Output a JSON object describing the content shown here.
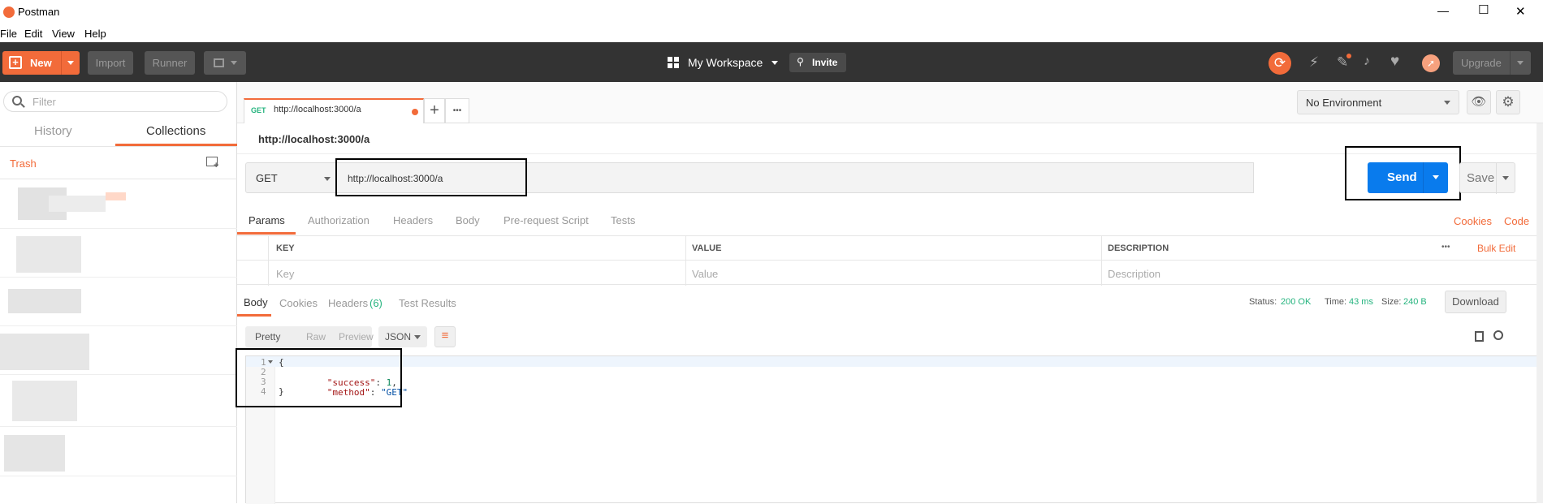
{
  "window": {
    "title": "Postman",
    "controls": {
      "minimize": "—",
      "maximize": "☐",
      "close": "✕"
    }
  },
  "menu": [
    "File",
    "Edit",
    "View",
    "Help"
  ],
  "toolbar": {
    "new_label": "New",
    "import_label": "Import",
    "runner_label": "Runner",
    "workspace_label": "My Workspace",
    "invite_label": "Invite",
    "upgrade_label": "Upgrade"
  },
  "sidebar": {
    "filter_placeholder": "Filter",
    "tabs": [
      "History",
      "Collections"
    ],
    "active_tab": "Collections",
    "trash_label": "Trash"
  },
  "request_tab": {
    "method": "GET",
    "url": "http://localhost:3000/a",
    "add_label": "+",
    "more_label": "•••"
  },
  "environment": {
    "selected": "No Environment"
  },
  "request": {
    "title": "http://localhost:3000/a",
    "method": "GET",
    "url": "http://localhost:3000/a",
    "send_label": "Send",
    "save_label": "Save"
  },
  "request_tabs": {
    "items": [
      "Params",
      "Authorization",
      "Headers",
      "Body",
      "Pre-request Script",
      "Tests"
    ],
    "active": "Params",
    "cookies_label": "Cookies",
    "code_label": "Code"
  },
  "params_table": {
    "headers": [
      "KEY",
      "VALUE",
      "DESCRIPTION"
    ],
    "placeholders": [
      "Key",
      "Value",
      "Description"
    ],
    "bulk_edit_label": "Bulk Edit",
    "more_label": "•••"
  },
  "response": {
    "tabs": [
      "Body",
      "Cookies",
      "Headers",
      "Test Results"
    ],
    "headers_count": "(6)",
    "active": "Body",
    "status_label": "Status:",
    "status_value": "200 OK",
    "time_label": "Time:",
    "time_value": "43 ms",
    "size_label": "Size:",
    "size_value": "240 B",
    "download_label": "Download",
    "view_modes": [
      "Pretty",
      "Raw",
      "Preview"
    ],
    "format": "JSON",
    "line_numbers": [
      "1",
      "2",
      "3",
      "4"
    ],
    "code": {
      "open": "{",
      "line2_key": "\"success\"",
      "line2_sep": ": ",
      "line2_val": "1",
      "line2_end": ",",
      "line3_key": "\"method\"",
      "line3_sep": ": ",
      "line3_val": "\"GET\"",
      "close": "}"
    }
  },
  "colors": {
    "accent": "#f26b3a",
    "send_blue": "#097bed",
    "status_green": "#26b47f",
    "toolbar_bg": "#333333",
    "json_key": "#a31515",
    "json_number": "#098658",
    "json_string": "#0451a5"
  },
  "icons": {
    "app": "postman-logo-icon",
    "search": "search-icon",
    "new_collection": "new-collection-icon",
    "sync": "sync-icon",
    "satellite": "satellite-icon",
    "settings_wrench": "wrench-icon",
    "bell": "bell-icon",
    "heart": "heart-icon",
    "rocket": "rocket-icon",
    "eye": "eye-icon",
    "gear": "gear-icon",
    "copy": "copy-icon",
    "magnifier": "search-icon",
    "wrap": "wrap-lines-icon"
  }
}
